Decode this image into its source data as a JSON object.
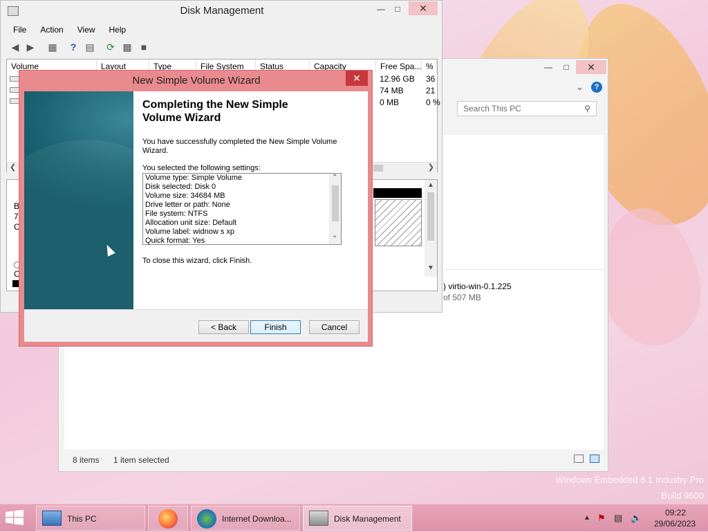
{
  "disk_management": {
    "title": "Disk Management",
    "menu": [
      "File",
      "Action",
      "View",
      "Help"
    ],
    "columns": [
      "Volume",
      "Layout",
      "Type",
      "File System",
      "Status",
      "Capacity",
      "Free Spa...",
      "% F"
    ],
    "rows": [
      {
        "free": "12.96 GB",
        "pct": "36"
      },
      {
        "free": "74 MB",
        "pct": "21"
      },
      {
        "free": "0 MB",
        "pct": "0 %"
      }
    ],
    "lower_fragments": [
      "B",
      "7",
      "C",
      "C"
    ]
  },
  "explorer": {
    "search_placeholder": "Search This PC",
    "device_name": ") virtio-win-0.1.225",
    "device_space": "of 507 MB",
    "status_items": "8 items",
    "status_selected": "1 item selected"
  },
  "wizard": {
    "title": "New Simple Volume Wizard",
    "heading": "Completing the New Simple Volume Wizard",
    "intro": "You have successfully completed the New Simple Volume Wizard.",
    "settings_label": "You selected the following settings:",
    "settings": [
      "Volume type: Simple Volume",
      "Disk selected: Disk 0",
      "Volume size: 34684 MB",
      "Drive letter or path: None",
      "File system: NTFS",
      "Allocation unit size: Default",
      "Volume label: widnow s xp",
      "Quick format: Yes"
    ],
    "close_hint": "To close this wizard, click Finish.",
    "back_label": "< Back",
    "finish_label": "Finish",
    "cancel_label": "Cancel"
  },
  "desktop": {
    "watermark_line1": "Windows Embedded 8.1 Industry Pro",
    "watermark_line2": "Build 9600"
  },
  "taskbar": {
    "items": [
      "This PC",
      "Internet Downloa...",
      "Disk Management"
    ],
    "time": "09:22",
    "date": "29/06/2023"
  },
  "colors": {
    "wizard_frame": "#e98a8e",
    "close_red": "#c7373c",
    "taskbar": "#dd93ab"
  }
}
